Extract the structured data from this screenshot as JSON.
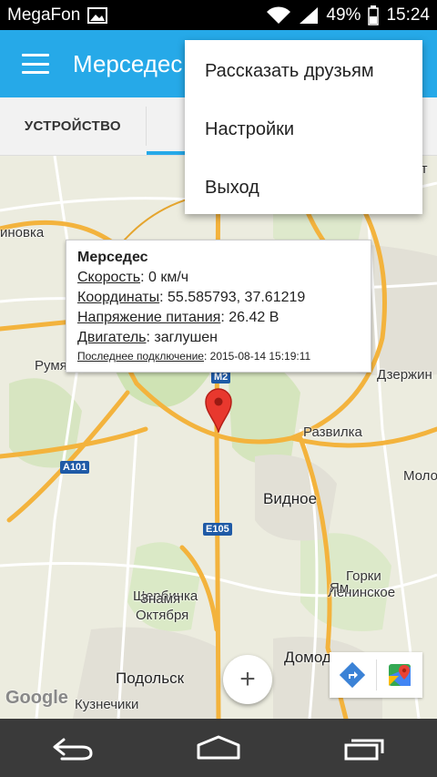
{
  "status_bar": {
    "carrier": "MegaFon",
    "battery": "49%",
    "time": "15:24"
  },
  "app_bar": {
    "title": "Мерседес"
  },
  "tabs": [
    {
      "label": "УСТРОЙСТВО",
      "active": false
    },
    {
      "label": "",
      "active": true
    },
    {
      "label": "",
      "active": false
    }
  ],
  "overflow_menu": {
    "items": [
      "Рассказать друзьям",
      "Настройки",
      "Выход"
    ]
  },
  "info_window": {
    "title": "Мерседес",
    "speed_label": "Скорость",
    "speed_value": "0 км/ч",
    "coords_label": "Координаты",
    "coords_value": "55.585793, 37.61219",
    "voltage_label": "Напряжение питания",
    "voltage_value": "26.42 В",
    "engine_label": "Двигатель",
    "engine_value": "заглушен",
    "last_conn_label": "Последнее подключение",
    "last_conn_value": "2015-08-14 15:19:11"
  },
  "map": {
    "places": {
      "novka": "иновка",
      "rumyantsevo": "Румянцево",
      "dzerzhinsky": "Дзержин",
      "razvilka": "Развилка",
      "vidnoe": "Видное",
      "molo": "Моло",
      "gorki": "Горки",
      "leninskoe": "Ленинское",
      "yam": "Ям",
      "shcherbinka": "Щербинка",
      "znamya": "Знамя",
      "oktyabrya": "Октября",
      "podolsk": "Подольск",
      "domodedovo": "Домодедово",
      "kuznechiki": "Кузнечики",
      "eu": "еут"
    },
    "shields": {
      "m2": "M2",
      "a101": "A101",
      "e105": "E105"
    },
    "zoom_in_label": "+",
    "logo": "Google"
  },
  "colors": {
    "accent": "#26a9e8",
    "road_major": "#f3b33d",
    "map_bg": "#ececdf",
    "park": "#cfe3b4"
  }
}
